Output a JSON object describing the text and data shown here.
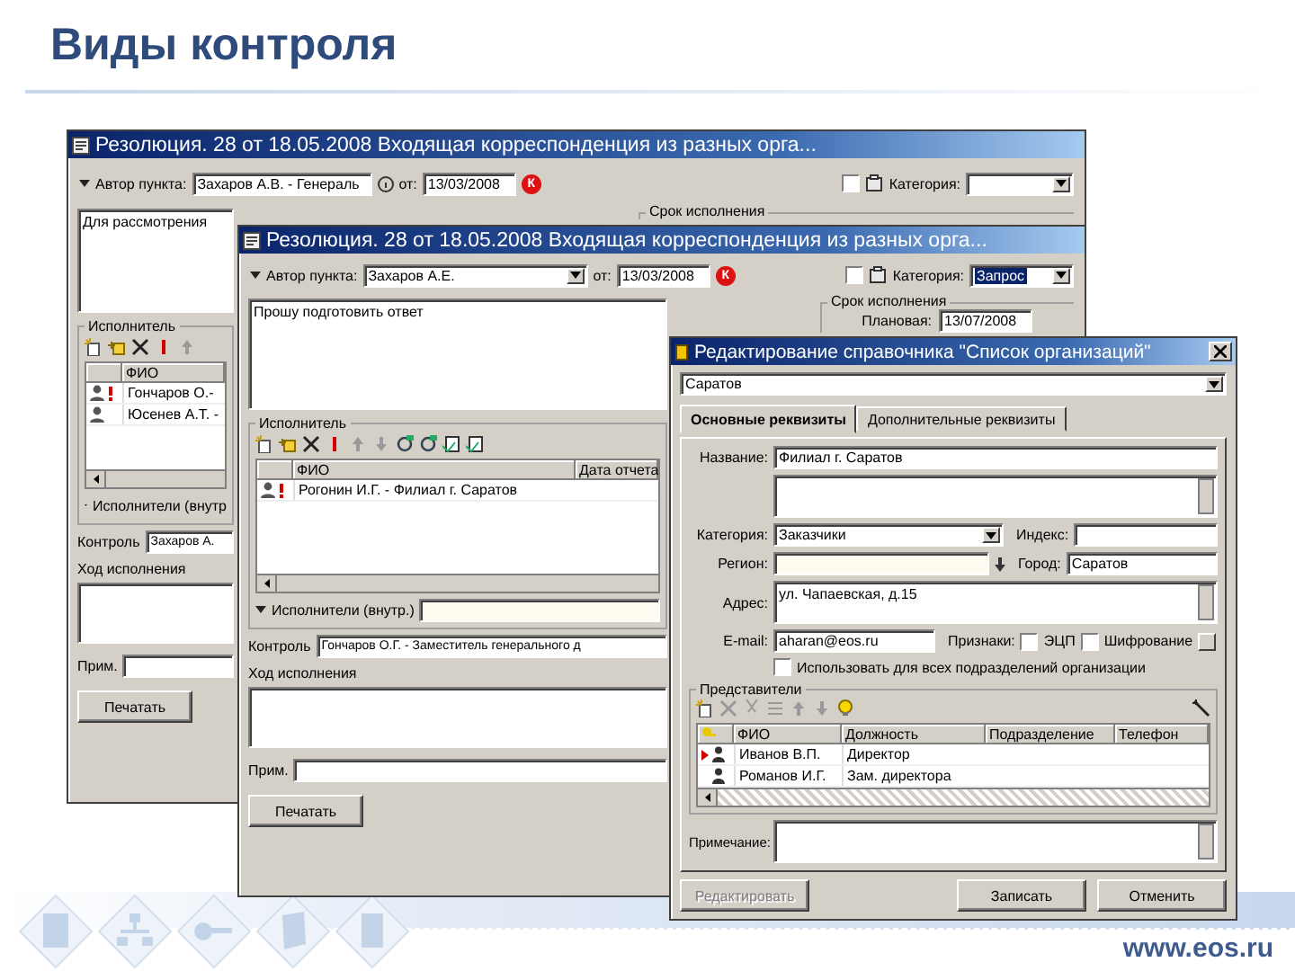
{
  "slide": {
    "title": "Виды контроля",
    "url": "www.eos.ru"
  },
  "back_window": {
    "title": "Резолюция. 28 от 18.05.2008 Входящая корреспонденция из разных орга...",
    "author_label": "Автор пункта:",
    "author_dropdown": false,
    "author": "Захаров А.В. - Генераль",
    "date_label": "от:",
    "date": "13/03/2008",
    "badge": "К",
    "flag_checked": false,
    "category_label": "Категория:",
    "deadline_legend": "Срок исполнения",
    "text": "Для рассмотрения",
    "executors_legend": "Исполнитель",
    "columns": [
      "ФИО"
    ],
    "executors": [
      {
        "name": "Гончаров О.-",
        "urgent": true
      },
      {
        "name": "Юсенев А.Т. -",
        "urgent": false
      }
    ],
    "internal_label": "Исполнители (внутр",
    "control_label": "Контроль",
    "control": "Захаров А.",
    "progress_label": "Ход исполнения",
    "note_label": "Прим.",
    "print_button": "Печатать"
  },
  "middle_window": {
    "title": "Резолюция. 28 от 18.05.2008 Входящая корреспонденция из разных орга...",
    "author_label": "Автор пункта:",
    "author_dropdown": true,
    "author": "Захаров А.Е.",
    "date_label": "от:",
    "date": "13/03/2008",
    "badge": "К",
    "flag_checked": false,
    "category_label": "Категория:",
    "category": "Запрос",
    "deadline_legend": "Срок исполнения",
    "planned_label": "Плановая:",
    "planned": "13/07/2008",
    "text": "Прошу подготовить ответ",
    "executors_legend": "Исполнитель",
    "columns": [
      "ФИО",
      "Дата отчета"
    ],
    "executors": [
      {
        "name": "Рогонин И.Г. - Филиал г. Саратов",
        "urgent": true
      }
    ],
    "internal_label": "Исполнители (внутр.)",
    "control_label": "Контроль",
    "control": "Гончаров О.Г. - Заместитель генерального д",
    "progress_label": "Ход исполнения",
    "note_label": "Прим.",
    "print_button": "Печатать"
  },
  "front_window": {
    "title": "Редактирование справочника \"Список организаций\"",
    "selector": "Саратов",
    "tabs": [
      {
        "label": "Основные реквизиты",
        "selected": true
      },
      {
        "label": "Дополнительные реквизиты",
        "selected": false
      }
    ],
    "name_label": "Название:",
    "name": "Филиал г. Саратов",
    "category_label": "Категория:",
    "category": "Заказчики",
    "index_label": "Индекс:",
    "region_label": "Регион:",
    "city_label": "Город:",
    "city": "Саратов",
    "address_label": "Адрес:",
    "address": "ул. Чапаевская, д.15",
    "email_label": "E-mail:",
    "email": "aharan@eos.ru",
    "signs_label": "Признаки:",
    "signs": [
      {
        "label": "ЭЦП",
        "checked": false
      },
      {
        "label": "Шифрование",
        "checked": false
      }
    ],
    "all_units": {
      "label": "Использовать для всех подразделений организации",
      "checked": false
    },
    "reps_legend": "Представители",
    "reps_columns": [
      "ФИО",
      "Должность",
      "Подразделение",
      "Телефон"
    ],
    "reps": [
      {
        "name": "Иванов В.П.",
        "position": "Директор",
        "current": true
      },
      {
        "name": "Романов И.Г.",
        "position": "Зам. директора",
        "current": false
      }
    ],
    "note_label": "Примечание:",
    "buttons": [
      {
        "label": "Редактировать",
        "disabled": true
      },
      {
        "label": "Записать",
        "disabled": false
      },
      {
        "label": "Отменить",
        "disabled": false
      }
    ]
  }
}
